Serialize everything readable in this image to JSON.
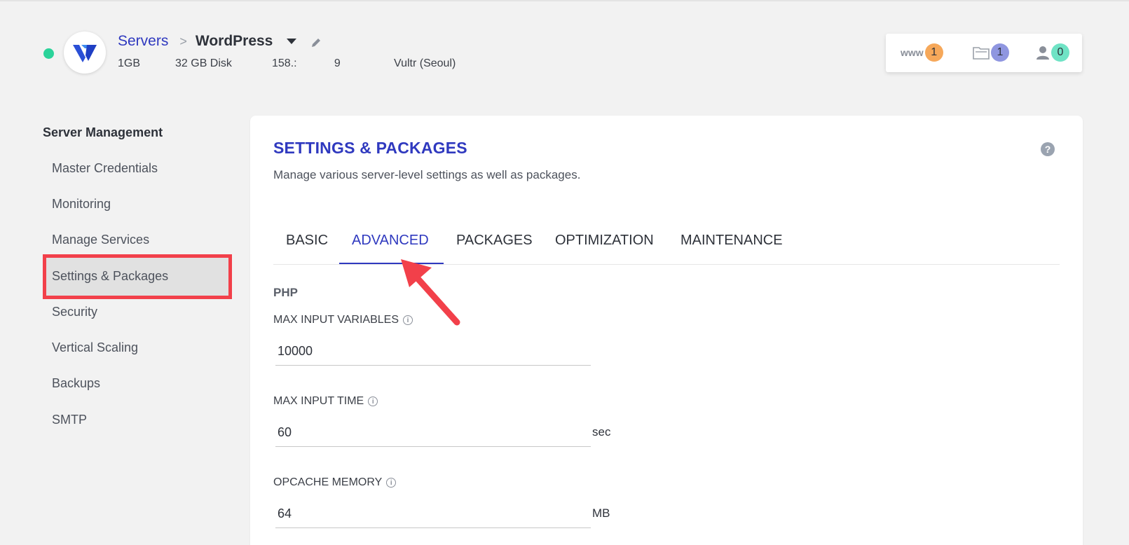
{
  "header": {
    "breadcrumb_root": "Servers",
    "breadcrumb_sep": ">",
    "server_name": "WordPress",
    "size": "1GB",
    "disk": "32 GB Disk",
    "ip": "158.:            9",
    "provider": "Vultr (Seoul)",
    "status_color": "#2bd39a"
  },
  "stats": {
    "www_label": "www",
    "www_count": "1",
    "apps_count": "1",
    "users_count": "0"
  },
  "sidebar": {
    "title": "Server Management",
    "items": [
      {
        "label": "Master Credentials"
      },
      {
        "label": "Monitoring"
      },
      {
        "label": "Manage Services"
      },
      {
        "label": "Settings & Packages",
        "active": true
      },
      {
        "label": "Security"
      },
      {
        "label": "Vertical Scaling"
      },
      {
        "label": "Backups"
      },
      {
        "label": "SMTP"
      }
    ]
  },
  "main": {
    "title": "SETTINGS & PACKAGES",
    "subtitle": "Manage various server-level settings as well as packages.",
    "tabs": [
      {
        "label": "BASIC"
      },
      {
        "label": "ADVANCED",
        "active": true
      },
      {
        "label": "PACKAGES"
      },
      {
        "label": "OPTIMIZATION"
      },
      {
        "label": "MAINTENANCE"
      }
    ],
    "section": "PHP",
    "fields": [
      {
        "label": "MAX INPUT VARIABLES",
        "value": "10000",
        "unit": ""
      },
      {
        "label": "MAX INPUT TIME",
        "value": "60",
        "unit": "sec"
      },
      {
        "label": "OPCACHE MEMORY",
        "value": "64",
        "unit": "MB"
      }
    ]
  },
  "colors": {
    "accent": "#2f39bf",
    "highlight_border": "#f2404a",
    "annotation_arrow": "#f2404a"
  }
}
